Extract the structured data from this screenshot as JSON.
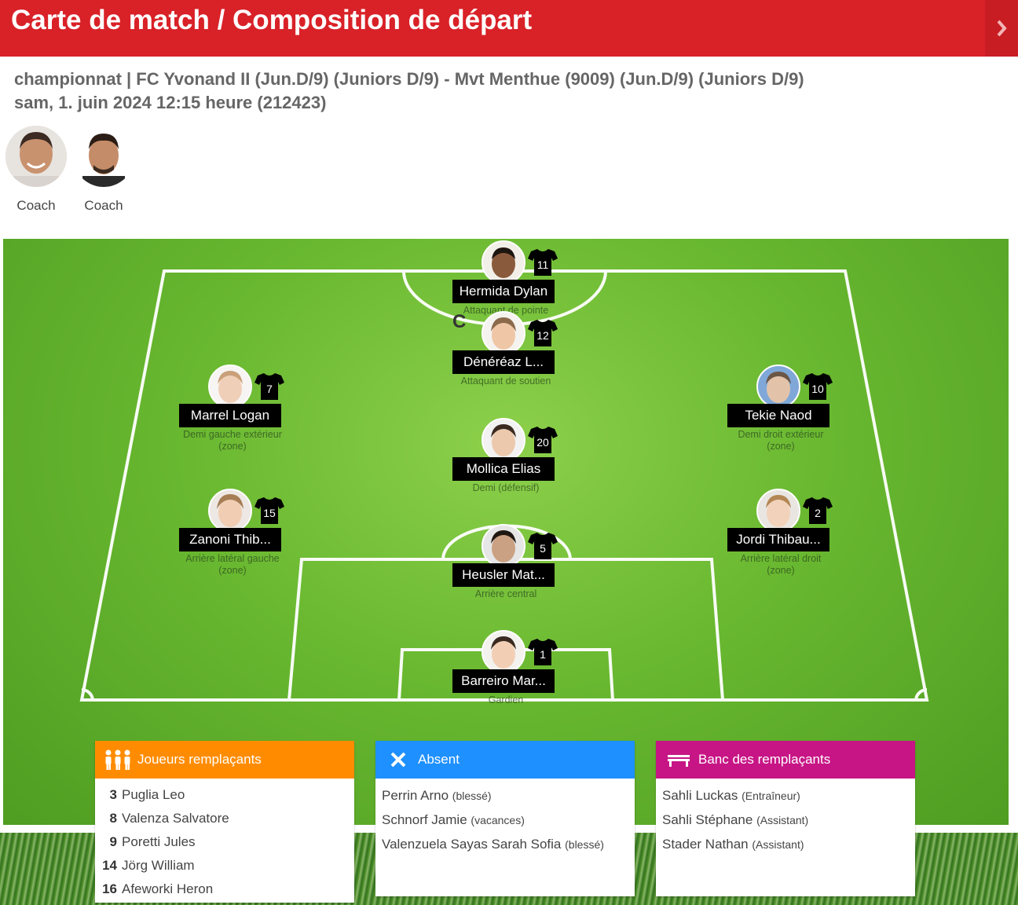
{
  "header": {
    "title": "Carte de match / Composition de départ"
  },
  "match": {
    "line1": "championnat | FC Yvonand II (Jun.D/9) (Juniors D/9) - Mvt Menthue (9009) (Jun.D/9) (Juniors D/9)",
    "line2": "sam, 1. juin 2024 12:15 heure (212423)"
  },
  "coaches": [
    {
      "label": "Coach"
    },
    {
      "label": "Coach"
    }
  ],
  "captain_mark": "C",
  "players": [
    {
      "number": "11",
      "name": "Hermida Dylan",
      "position": "Attaquant de pointe"
    },
    {
      "number": "12",
      "name": "Dénéréaz L...",
      "position": "Attaquant de soutien"
    },
    {
      "number": "7",
      "name": "Marrel Logan",
      "position": "Demi gauche extérieur (zone)"
    },
    {
      "number": "10",
      "name": "Tekie Naod",
      "position": "Demi droit extérieur (zone)"
    },
    {
      "number": "20",
      "name": "Mollica Elias",
      "position": "Demi (défensif)"
    },
    {
      "number": "15",
      "name": "Zanoni Thib...",
      "position": "Arrière latéral gauche (zone)"
    },
    {
      "number": "2",
      "name": "Jordi Thibau...",
      "position": "Arrière latéral droit (zone)"
    },
    {
      "number": "5",
      "name": "Heusler Mat...",
      "position": "Arrière central"
    },
    {
      "number": "1",
      "name": "Barreiro Mar...",
      "position": "Gardien"
    }
  ],
  "substitutes": {
    "title": "Joueurs remplaçants",
    "color": "#ff8c00",
    "items": [
      {
        "number": "3",
        "name": "Puglia Leo"
      },
      {
        "number": "8",
        "name": "Valenza Salvatore"
      },
      {
        "number": "9",
        "name": "Poretti Jules"
      },
      {
        "number": "14",
        "name": "Jörg William"
      },
      {
        "number": "16",
        "name": "Afeworki Heron"
      }
    ]
  },
  "absent": {
    "title": "Absent",
    "color": "#1e90ff",
    "items": [
      {
        "name": "Perrin Arno",
        "note": "(blessé)"
      },
      {
        "name": "Schnorf Jamie",
        "note": "(vacances)"
      },
      {
        "name": "Valenzuela Sayas Sarah Sofia",
        "note": "(blessé)"
      }
    ]
  },
  "bench": {
    "title": "Banc des remplaçants",
    "color": "#c71585",
    "items": [
      {
        "name": "Sahli Luckas",
        "note": "(Entraîneur)"
      },
      {
        "name": "Sahli Stéphane",
        "note": "(Assistant)"
      },
      {
        "name": "Stader Nathan",
        "note": "(Assistant)"
      }
    ]
  }
}
